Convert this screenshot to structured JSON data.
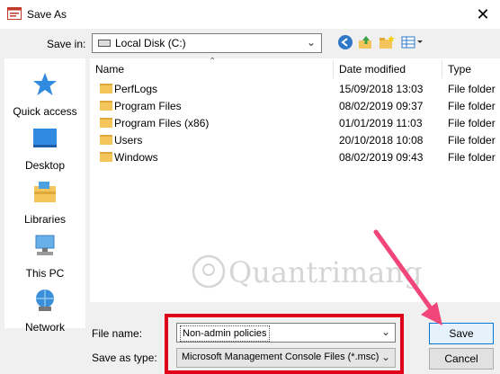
{
  "window": {
    "title": "Save As"
  },
  "save_in": {
    "label": "Save in:",
    "value": "Local Disk (C:)"
  },
  "places": [
    {
      "label": "Quick access",
      "icon": "star-icon"
    },
    {
      "label": "Desktop",
      "icon": "desktop-icon"
    },
    {
      "label": "Libraries",
      "icon": "libraries-icon"
    },
    {
      "label": "This PC",
      "icon": "computer-icon"
    },
    {
      "label": "Network",
      "icon": "network-icon"
    }
  ],
  "columns": {
    "name": "Name",
    "date": "Date modified",
    "type": "Type"
  },
  "files": [
    {
      "name": "PerfLogs",
      "date": "15/09/2018 13:03",
      "type": "File folder"
    },
    {
      "name": "Program Files",
      "date": "08/02/2019 09:37",
      "type": "File folder"
    },
    {
      "name": "Program Files (x86)",
      "date": "01/01/2019 11:03",
      "type": "File folder"
    },
    {
      "name": "Users",
      "date": "20/10/2018 10:08",
      "type": "File folder"
    },
    {
      "name": "Windows",
      "date": "08/02/2019 09:43",
      "type": "File folder"
    }
  ],
  "file_name": {
    "label": "File name:",
    "value": "Non-admin policies"
  },
  "save_as_type": {
    "label": "Save as type:",
    "value": "Microsoft Management Console Files (*.msc)"
  },
  "buttons": {
    "save": "Save",
    "cancel": "Cancel"
  },
  "watermark": {
    "text": "Quantrimang"
  },
  "colors": {
    "highlight_box": "#e0001a",
    "arrow": "#f0467a",
    "accent": "#0078d7"
  }
}
